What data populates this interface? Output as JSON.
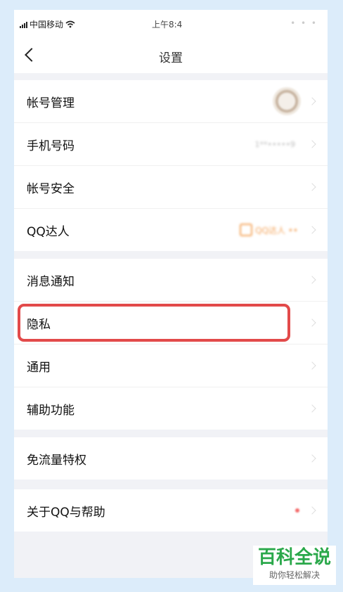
{
  "status_bar": {
    "carrier": "中国移动",
    "time": "上午8:4",
    "right_blur": "• • •"
  },
  "nav": {
    "title": "设置"
  },
  "groups": [
    {
      "items": [
        {
          "label": "帐号管理"
        },
        {
          "label": "手机号码",
          "value": "1**•••••9"
        },
        {
          "label": "帐号安全"
        },
        {
          "label": "QQ达人",
          "badge": "QQ达人 ••"
        }
      ]
    },
    {
      "items": [
        {
          "label": "消息通知"
        },
        {
          "label": "隐私"
        },
        {
          "label": "通用"
        },
        {
          "label": "辅助功能"
        }
      ]
    },
    {
      "items": [
        {
          "label": "免流量特权"
        }
      ]
    },
    {
      "items": [
        {
          "label": "关于QQ与帮助"
        }
      ]
    }
  ],
  "watermark": {
    "title": "百科全说",
    "subtitle": "助你轻松解决"
  },
  "colors": {
    "highlight": "#e24a4a",
    "accent": "#2aa84a",
    "badge": "#f4a45a"
  }
}
